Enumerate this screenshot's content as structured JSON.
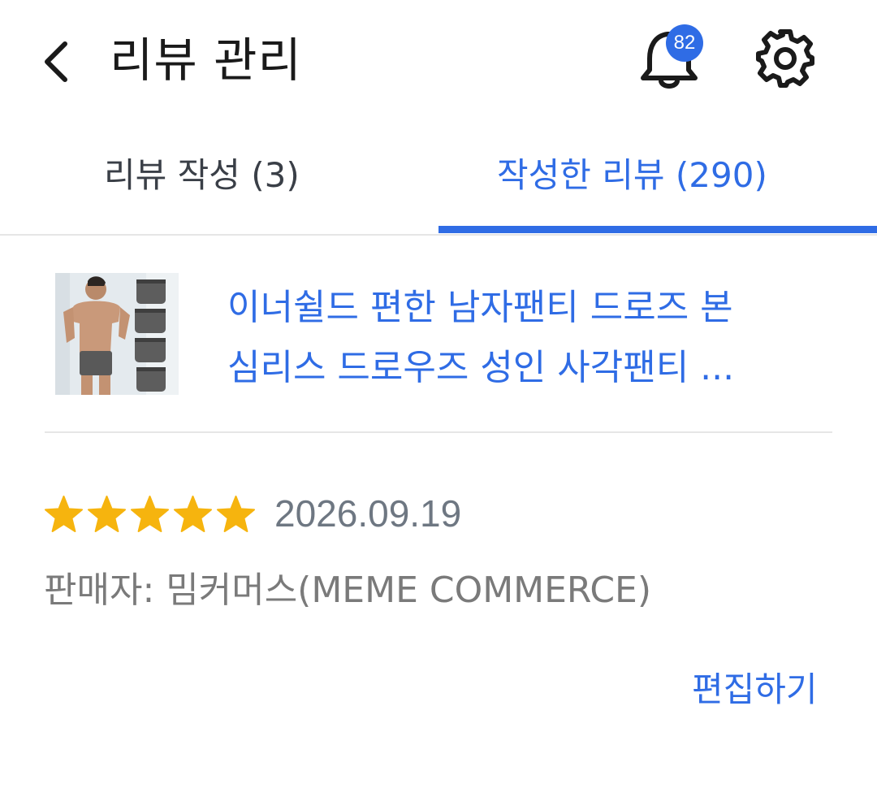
{
  "header": {
    "title": "리뷰 관리",
    "notification_count": "82"
  },
  "tabs": [
    {
      "label": "리뷰 작성 (3)",
      "active": false
    },
    {
      "label": "작성한 리뷰 (290)",
      "active": true
    }
  ],
  "review": {
    "product_name_line1": "이너쉴드 편한 남자팬티 드로즈 본",
    "product_name_line2": "심리스 드로우즈 성인 사각팬티 ...",
    "rating": 5,
    "date": "2026.09.19",
    "seller": "판매자: 밈커머스(MEME COMMERCE)",
    "edit_label": "편집하기"
  },
  "colors": {
    "accent": "#2f6ce5",
    "star": "#f6b40e",
    "muted_text": "#7a7a7a"
  },
  "icons": {
    "back": "chevron-left-icon",
    "notifications": "bell-icon",
    "settings": "gear-icon"
  }
}
